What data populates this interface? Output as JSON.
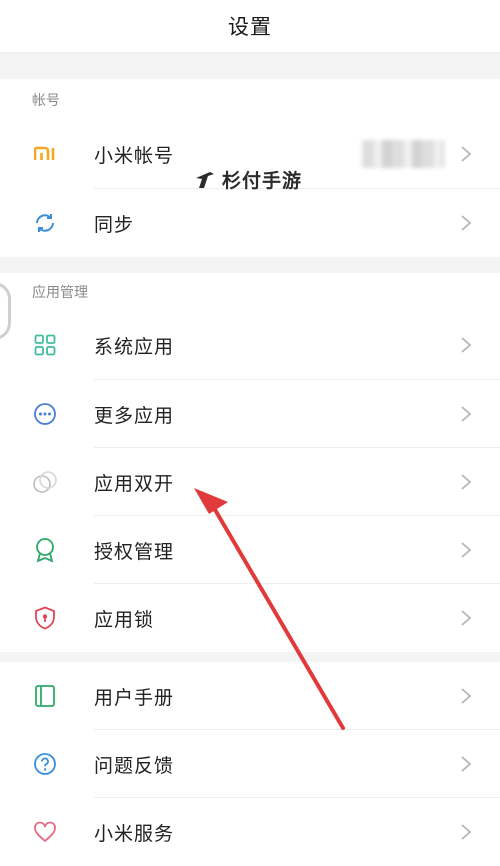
{
  "header": {
    "title": "设置"
  },
  "sections": [
    {
      "label": "帐号",
      "items": [
        {
          "label": "小米帐号",
          "icon": "mi-logo-icon"
        },
        {
          "label": "同步",
          "icon": "sync-icon"
        }
      ]
    },
    {
      "label": "应用管理",
      "items": [
        {
          "label": "系统应用",
          "icon": "grid-apps-icon"
        },
        {
          "label": "更多应用",
          "icon": "more-dots-icon"
        },
        {
          "label": "应用双开",
          "icon": "dual-circles-icon"
        },
        {
          "label": "授权管理",
          "icon": "badge-ribbon-icon"
        },
        {
          "label": "应用锁",
          "icon": "shield-lock-icon"
        }
      ]
    },
    {
      "label": "",
      "items": [
        {
          "label": "用户手册",
          "icon": "manual-book-icon"
        },
        {
          "label": "问题反馈",
          "icon": "question-circle-icon"
        },
        {
          "label": "小米服务",
          "icon": "heart-icon"
        }
      ]
    }
  ],
  "watermark": {
    "text": "杉付手游"
  },
  "colors": {
    "mi_orange": "#f5a623",
    "sync_blue": "#3a8fd8",
    "teal": "#3fbf9e",
    "blue": "#4a7fd6",
    "green": "#2fa86a",
    "red": "#e0475a",
    "pink": "#e86a86",
    "arrow_red": "#e23a3a"
  }
}
